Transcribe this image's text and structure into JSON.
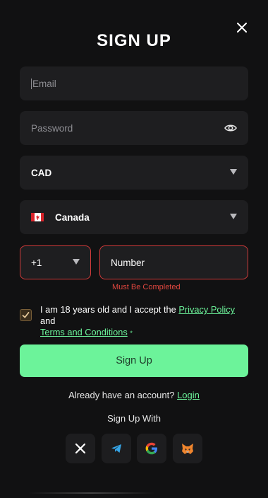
{
  "modal": {
    "title": "SIGN UP",
    "close_icon": "close-icon"
  },
  "form": {
    "email": {
      "placeholder": "Email",
      "value": ""
    },
    "password": {
      "placeholder": "Password",
      "value": "",
      "icon": "eye-icon"
    },
    "currency": {
      "value": "CAD"
    },
    "country": {
      "value": "Canada",
      "flag_icon": "canada-flag-icon"
    },
    "phone_code": {
      "value": "+1"
    },
    "phone_number": {
      "placeholder": "Number",
      "value": "",
      "error": "Must Be Completed"
    },
    "terms": {
      "checked": true,
      "text_before": "I am 18 years old and I accept the ",
      "privacy_link": "Privacy Policy",
      "text_middle": " and",
      "terms_link": "Terms and Conditions",
      "required_mark": "*"
    },
    "submit_label": "Sign Up"
  },
  "footer": {
    "already_text": "Already have an account?",
    "login_link": "Login",
    "sign_up_with": "Sign Up With",
    "social": [
      {
        "name": "x-icon"
      },
      {
        "name": "telegram-icon"
      },
      {
        "name": "google-icon"
      },
      {
        "name": "metamask-icon"
      }
    ]
  },
  "colors": {
    "background": "#111112",
    "field": "#1e1e20",
    "accent": "#6cf39a",
    "error": "#e0473f"
  }
}
